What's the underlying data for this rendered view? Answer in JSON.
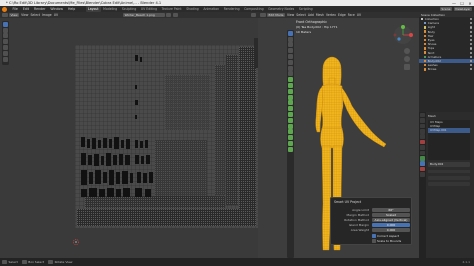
{
  "window": {
    "title": "* C:\\Ro Edit\\3D Library\\Documents\\Me_Files\\Blender\\Cobra Edit\\Anime\\... - Blender 4.1",
    "minimize": "—",
    "maximize": "☐",
    "close": "✕"
  },
  "menu": {
    "items": [
      "File",
      "Edit",
      "Render",
      "Window",
      "Help"
    ],
    "workspaces": [
      "Layout",
      "Modeling",
      "Sculpting",
      "UV Editing",
      "Texture Paint",
      "Shading",
      "Animation",
      "Rendering",
      "Compositing",
      "Geometry Nodes",
      "Scripting"
    ],
    "active_workspace": "Layout",
    "scene_label": "Scene",
    "viewlayer_label": "ViewLayer"
  },
  "uv_editor": {
    "mode": "View",
    "menu": [
      "View",
      "Select",
      "Image",
      "UV"
    ],
    "image_name": "Winter_Beach 1.png"
  },
  "viewport": {
    "mode": "Edit Mode",
    "menu": [
      "View",
      "Select",
      "Add",
      "Mesh",
      "Vertex",
      "Edge",
      "Face",
      "UV"
    ],
    "overlay_title": "Front Orthographic",
    "overlay_object": "(0) Tae Body.002 : Hip 1771",
    "overlay_units": "10 Meters"
  },
  "redo_panel": {
    "title": "Smart UV Project",
    "angle_limit_label": "Angle Limit",
    "angle_limit_value": "66°",
    "margin_method_label": "Margin Method",
    "margin_method_value": "Scaled",
    "rotation_method_label": "Rotation Method",
    "rotation_method_value": "Axis-aligned (Vertical)",
    "island_margin_label": "Island Margin",
    "island_margin_value": "0.000",
    "area_weight_label": "Area Weight",
    "area_weight_value": "0.000",
    "correct_aspect_label": "Correct Aspect",
    "scale_to_bounds_label": "Scale to Bounds"
  },
  "outliner": {
    "header": "Scene Collection",
    "rows": [
      {
        "label": "Collection",
        "color": "#cfcfcf"
      },
      {
        "label": "Camera",
        "color": "#7b9ed0"
      },
      {
        "label": "Light",
        "color": "#d8c46a"
      },
      {
        "label": "Body",
        "color": "#e08e3a"
      },
      {
        "label": "Hair",
        "color": "#e08e3a"
      },
      {
        "label": "Eyes",
        "color": "#e08e3a"
      },
      {
        "label": "Shoes",
        "color": "#e08e3a"
      },
      {
        "label": "Tops",
        "color": "#e08e3a"
      },
      {
        "label": "Skirt",
        "color": "#e08e3a"
      },
      {
        "label": "Armature",
        "color": "#5aa05a"
      },
      {
        "label": "Body.002",
        "color": "#e08e3a"
      },
      {
        "label": "Lashes",
        "color": "#e08e3a"
      },
      {
        "label": "Brows",
        "color": "#e08e3a"
      }
    ]
  },
  "properties": {
    "entries": [
      "UV Maps",
      "UVMap",
      "UVMap.001"
    ],
    "selected_entry": "UVMap.001",
    "section": "Mesh",
    "active_list_item": "Body.002"
  },
  "status": {
    "left": [
      "Select",
      "Box Select",
      "Rotate View"
    ],
    "right": "4.1.1"
  },
  "colors": {
    "accent": "#4772b3",
    "model": "#f2b51c",
    "logo": "#e87d0d"
  }
}
